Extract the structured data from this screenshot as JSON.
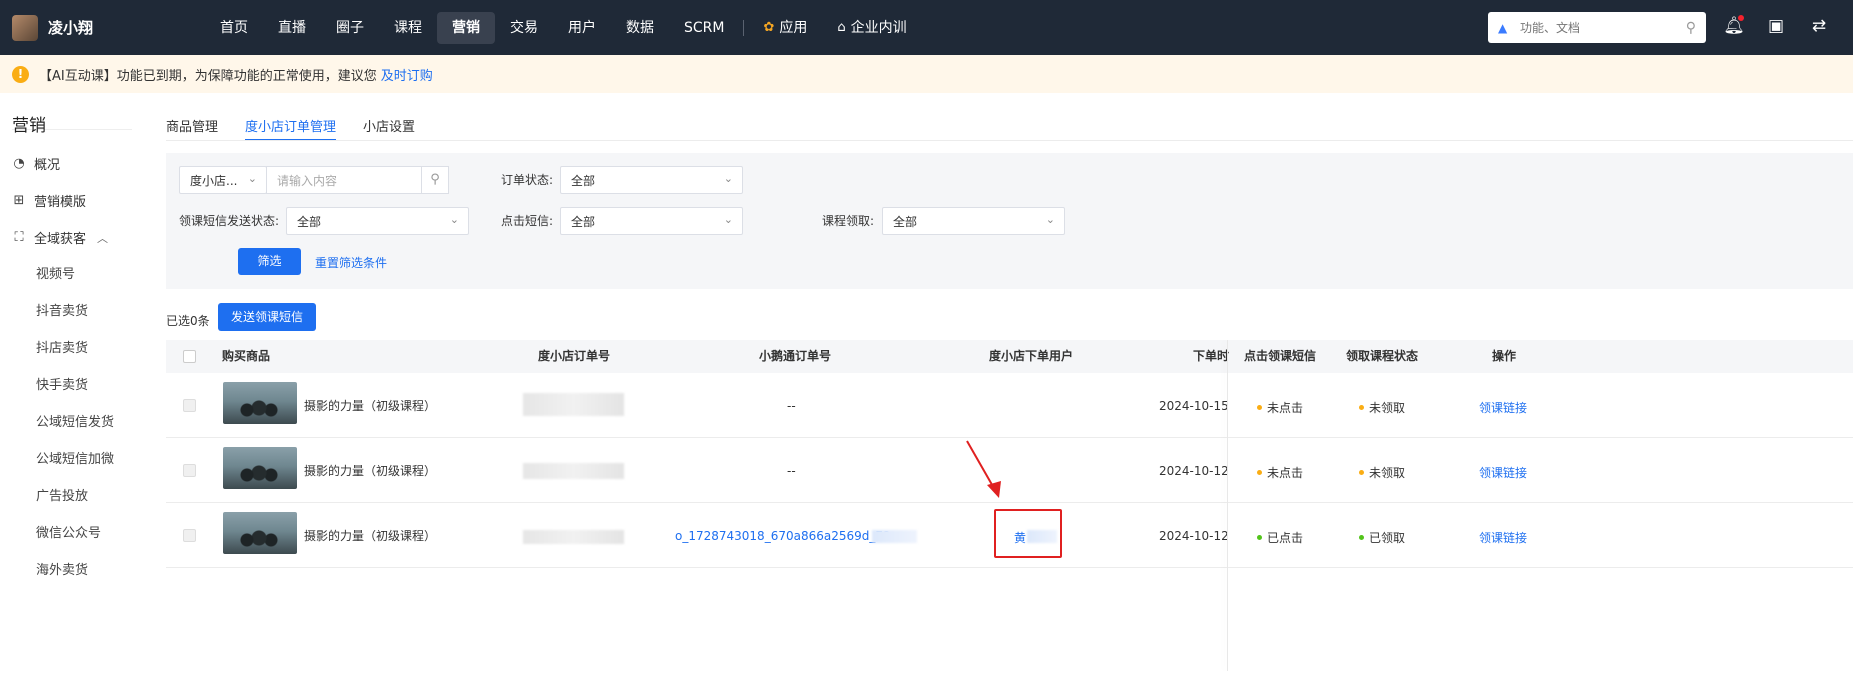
{
  "topbar": {
    "brand": "凌小翔",
    "nav": [
      {
        "label": "首页",
        "active": false
      },
      {
        "label": "直播",
        "active": false
      },
      {
        "label": "圈子",
        "active": false
      },
      {
        "label": "课程",
        "active": false
      },
      {
        "label": "营销",
        "active": true
      },
      {
        "label": "交易",
        "active": false
      },
      {
        "label": "用户",
        "active": false
      },
      {
        "label": "数据",
        "active": false
      },
      {
        "label": "SCRM",
        "active": false
      }
    ],
    "apps_label": "应用",
    "training_label": "企业内训",
    "search_placeholder": "功能、文档"
  },
  "notice": {
    "text": "【AI互动课】功能已到期，为保障功能的正常使用，建议您",
    "link": "及时订购"
  },
  "sidebar": {
    "title": "营销",
    "items": [
      {
        "label": "概况",
        "icon": "pie-chart-icon"
      },
      {
        "label": "营销模版",
        "icon": "grid-icon"
      },
      {
        "label": "全域获客",
        "icon": "user-scan-icon",
        "expanded": true
      }
    ],
    "subitems": [
      "视频号",
      "抖音卖货",
      "抖店卖货",
      "快手卖货",
      "公域短信发货",
      "公域短信加微",
      "广告投放",
      "微信公众号",
      "海外卖货"
    ]
  },
  "tabs": [
    {
      "label": "商品管理",
      "active": false
    },
    {
      "label": "度小店订单管理",
      "active": true
    },
    {
      "label": "小店设置",
      "active": false
    }
  ],
  "filter": {
    "type_select": "度小店...",
    "keyword_placeholder": "请输入内容",
    "order_status_label": "订单状态:",
    "order_status_value": "全部",
    "sms_status_label": "领课短信发送状态:",
    "sms_status_value": "全部",
    "click_sms_label": "点击短信:",
    "click_sms_value": "全部",
    "course_claim_label": "课程领取:",
    "course_claim_value": "全部",
    "filter_button": "筛选",
    "reset_link": "重置筛选条件"
  },
  "bulk": {
    "selected_text": "已选0条",
    "send_button": "发送领课短信"
  },
  "table": {
    "columns": [
      "购买商品",
      "度小店订单号",
      "小鹅通订单号",
      "度小店下单用户",
      "下单时",
      "点击领课短信",
      "领取课程状态",
      "操作"
    ],
    "rows": [
      {
        "product": "摄影的力量（初级课程）",
        "xet_order": "--",
        "user": "",
        "date": "2024-10-15",
        "click_status": "未点击",
        "claim_status": "未领取",
        "action": "领课链接"
      },
      {
        "product": "摄影的力量（初级课程）",
        "xet_order": "--",
        "user": "",
        "date": "2024-10-12",
        "click_status": "未点击",
        "claim_status": "未领取",
        "action": "领课链接"
      },
      {
        "product": "摄影的力量（初级课程）",
        "xet_order": "o_1728743018_670a866a2569d_72",
        "user": "黄",
        "date": "2024-10-12",
        "click_status": "已点击",
        "claim_status": "已领取",
        "action": "领课链接"
      }
    ]
  },
  "colors": {
    "topbar_bg": "#1f2937",
    "accent": "#1e6ff0",
    "warning": "#faad14",
    "success": "#52c41a",
    "annotation": "#e02020"
  }
}
